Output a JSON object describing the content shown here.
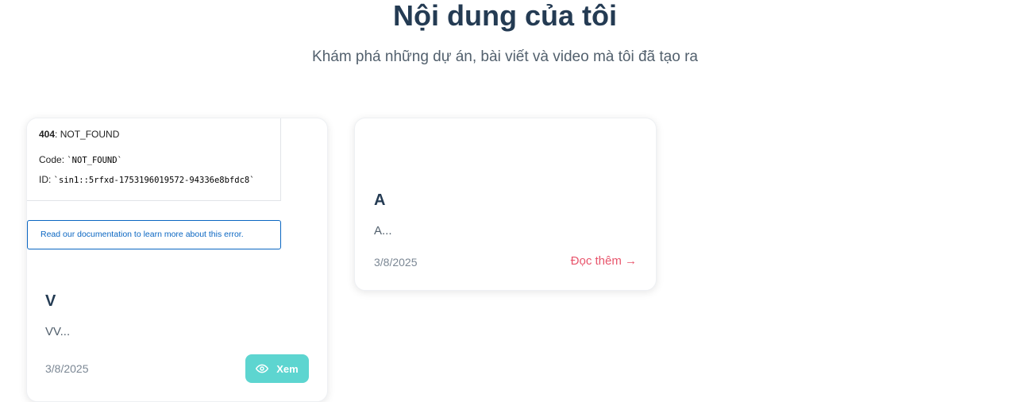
{
  "header": {
    "title": "Nội dung của tôi",
    "subtitle": "Khám phá những dự án, bài viết và video mà tôi đã tạo ra"
  },
  "cards": [
    {
      "error_frame": {
        "status_code": "404",
        "status_text": ": NOT_FOUND",
        "code_label": "Code: ",
        "code_value": "`NOT_FOUND`",
        "id_label": "ID: ",
        "id_value": "`sin1::5rfxd-1753196019572-94336e8bfdc8`",
        "doc_link": "Read our documentation to learn more about this error."
      },
      "title": "V",
      "excerpt": "VV...",
      "date": "3/8/2025",
      "button_label": "Xem",
      "button_icon": "eye-icon"
    },
    {
      "title": "A",
      "excerpt": "A...",
      "date": "3/8/2025",
      "link_label": "Đọc thêm →"
    }
  ],
  "colors": {
    "heading": "#243b53",
    "accent_teal": "#5dd5d0",
    "accent_pink": "#e8556c",
    "link_blue": "#0a66c2"
  }
}
